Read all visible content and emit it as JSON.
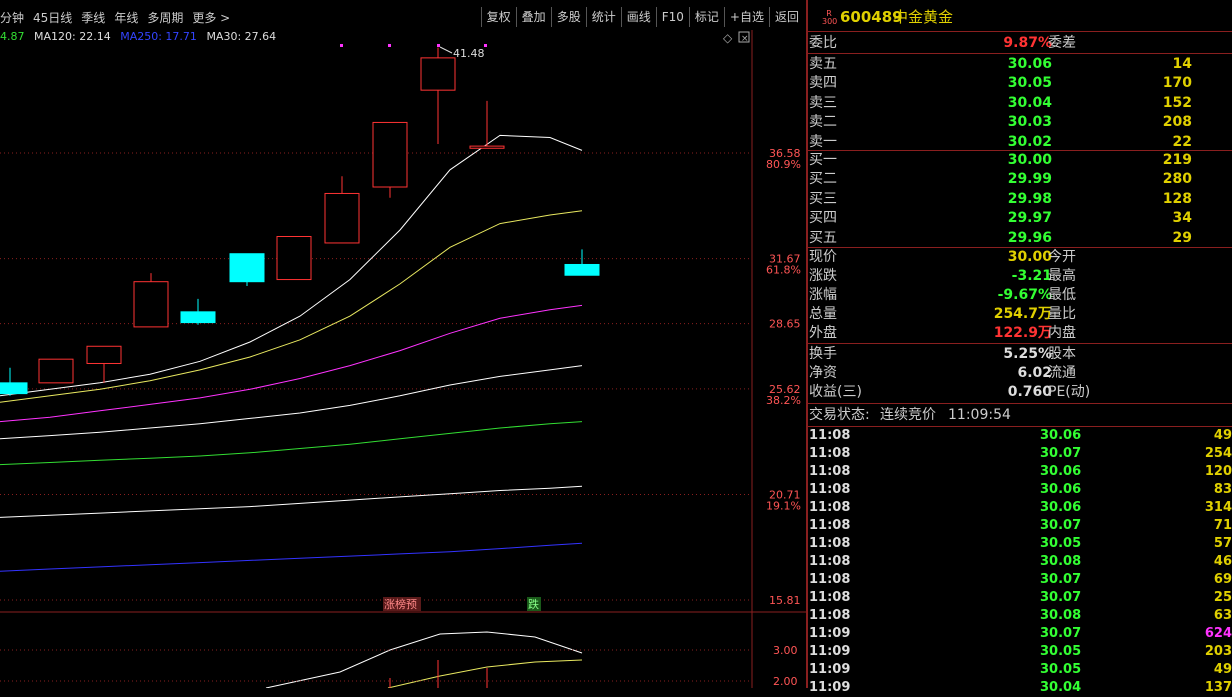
{
  "toolbar": {
    "left_tabs": [
      "分钟",
      "45日线",
      "季线",
      "年线",
      "多周期",
      "更多 >"
    ],
    "right_buttons": [
      "复权",
      "叠加",
      "多股",
      "统计",
      "画线",
      "F10",
      "标记",
      "+自选",
      "返回"
    ]
  },
  "ma_legend": {
    "ma_first": "4.87",
    "ma120": "MA120: 22.14",
    "ma250": "MA250: 17.71",
    "ma30": "MA30: 27.64"
  },
  "colors": {
    "up": "#ff3333",
    "down": "#00ffff",
    "ma_white": "#ffffff",
    "ma_yellow": "#e8e860",
    "ma_magenta": "#ff33ff",
    "ma_green": "#33dd33",
    "ma_blue": "#3333ff",
    "grid_red": "#8a1f1f"
  },
  "price_axis": [
    {
      "price": "36.58",
      "pct": "80.9%"
    },
    {
      "price": "31.67",
      "pct": "61.8%"
    },
    {
      "price": "28.65",
      "pct": ""
    },
    {
      "price": "25.62",
      "pct": "38.2%"
    },
    {
      "price": "20.71",
      "pct": "19.1%"
    },
    {
      "price": "15.81",
      "pct": ""
    }
  ],
  "peak_label": "41.48",
  "markers": {
    "limit_up": "涨榜预",
    "fall": "跌"
  },
  "sub_axis": [
    "3.00",
    "2.00"
  ],
  "chart_data": {
    "type": "candlestick",
    "note_visible": "",
    "candles": [
      {
        "open": 25.9,
        "close": 25.4,
        "high": 26.6,
        "low": 25.3
      },
      {
        "open": 25.9,
        "close": 27.0,
        "high": 27.0,
        "low": 25.9
      },
      {
        "open": 26.8,
        "close": 27.6,
        "high": 27.6,
        "low": 25.9
      },
      {
        "open": 28.5,
        "close": 30.6,
        "high": 31.0,
        "low": 28.5
      },
      {
        "open": 29.2,
        "close": 28.7,
        "high": 29.8,
        "low": 28.6
      },
      {
        "open": 31.9,
        "close": 30.6,
        "high": 31.9,
        "low": 30.4
      },
      {
        "open": 30.7,
        "close": 32.7,
        "high": 32.7,
        "low": 30.7
      },
      {
        "open": 32.4,
        "close": 34.7,
        "high": 35.5,
        "low": 32.4
      },
      {
        "open": 35.0,
        "close": 38.0,
        "high": 38.0,
        "low": 34.5
      },
      {
        "open": 39.5,
        "close": 41.0,
        "high": 41.48,
        "low": 37.0
      },
      {
        "open": 36.8,
        "close": 36.9,
        "high": 39.0,
        "low": 36.8
      },
      {
        "open": 31.4,
        "close": 30.9,
        "high": 32.1,
        "low": 30.9
      }
    ]
  },
  "quote": {
    "code": "600489",
    "name": "中金黄金",
    "badge_top": "R",
    "badge_bottom": "300",
    "weibi_label": "委比",
    "weibi_value": "9.87%",
    "weicha_label": "委差",
    "asks": [
      {
        "label": "卖五",
        "price": "30.06",
        "vol": "14"
      },
      {
        "label": "卖四",
        "price": "30.05",
        "vol": "170"
      },
      {
        "label": "卖三",
        "price": "30.04",
        "vol": "152"
      },
      {
        "label": "卖二",
        "price": "30.03",
        "vol": "208"
      },
      {
        "label": "卖一",
        "price": "30.02",
        "vol": "22"
      }
    ],
    "bids": [
      {
        "label": "买一",
        "price": "30.00",
        "vol": "219"
      },
      {
        "label": "买二",
        "price": "29.99",
        "vol": "280"
      },
      {
        "label": "买三",
        "price": "29.98",
        "vol": "128"
      },
      {
        "label": "买四",
        "price": "29.97",
        "vol": "34"
      },
      {
        "label": "买五",
        "price": "29.96",
        "vol": "29"
      }
    ],
    "stats1": [
      {
        "label": "现价",
        "value": "30.00",
        "label2": "今开"
      },
      {
        "label": "涨跌",
        "value": "-3.21",
        "label2": "最高"
      },
      {
        "label": "涨幅",
        "value": "-9.67%",
        "label2": "最低"
      },
      {
        "label": "总量",
        "value": "254.7万",
        "label2": "量比"
      },
      {
        "label": "外盘",
        "value": "122.9万",
        "label2": "内盘"
      }
    ],
    "stats2": [
      {
        "label": "换手",
        "value": "5.25%",
        "label2": "股本"
      },
      {
        "label": "净资",
        "value": "6.02",
        "label2": "流通"
      },
      {
        "label": "收益(三)",
        "value": "0.760",
        "label2": "PE(动)"
      }
    ],
    "trade_status_label": "交易状态:",
    "trade_status": "连续竞价",
    "trade_time": "11:09:54"
  },
  "ticks": [
    {
      "time": "11:08",
      "price": "30.06",
      "vol": "49"
    },
    {
      "time": "11:08",
      "price": "30.07",
      "vol": "254"
    },
    {
      "time": "11:08",
      "price": "30.06",
      "vol": "120"
    },
    {
      "time": "11:08",
      "price": "30.06",
      "vol": "83"
    },
    {
      "time": "11:08",
      "price": "30.06",
      "vol": "314"
    },
    {
      "time": "11:08",
      "price": "30.07",
      "vol": "71"
    },
    {
      "time": "11:08",
      "price": "30.05",
      "vol": "57"
    },
    {
      "time": "11:08",
      "price": "30.08",
      "vol": "46"
    },
    {
      "time": "11:08",
      "price": "30.07",
      "vol": "69"
    },
    {
      "time": "11:08",
      "price": "30.07",
      "vol": "25"
    },
    {
      "time": "11:08",
      "price": "30.08",
      "vol": "63"
    },
    {
      "time": "11:09",
      "price": "30.07",
      "vol": "624"
    },
    {
      "time": "11:09",
      "price": "30.05",
      "vol": "203"
    },
    {
      "time": "11:09",
      "price": "30.05",
      "vol": "49"
    },
    {
      "time": "11:09",
      "price": "30.04",
      "vol": "137"
    }
  ]
}
